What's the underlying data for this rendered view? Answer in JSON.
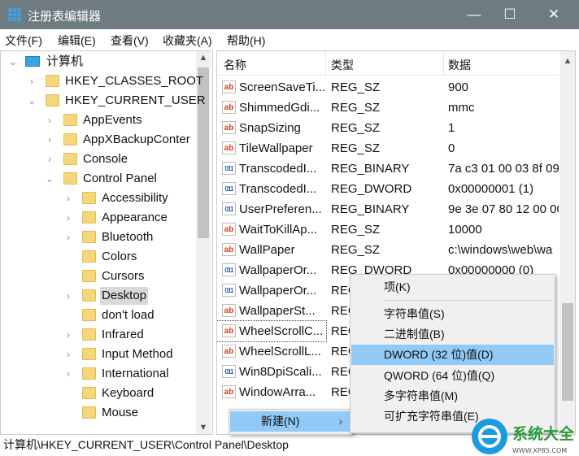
{
  "window": {
    "title": "注册表编辑器",
    "minimize": "—",
    "maximize": "☐",
    "close": "✕"
  },
  "menubar": [
    "文件(F)",
    "编辑(E)",
    "查看(V)",
    "收藏夹(A)",
    "帮助(H)"
  ],
  "tree": [
    {
      "label": "计算机",
      "level": 0,
      "expanded": true,
      "icon": "computer-icon"
    },
    {
      "label": "HKEY_CLASSES_ROOT",
      "level": 1,
      "expanded": false
    },
    {
      "label": "HKEY_CURRENT_USER",
      "level": 1,
      "expanded": true
    },
    {
      "label": "AppEvents",
      "level": 2,
      "expanded": false
    },
    {
      "label": "AppXBackupConter",
      "level": 2,
      "expanded": false
    },
    {
      "label": "Console",
      "level": 2,
      "expanded": false
    },
    {
      "label": "Control Panel",
      "level": 2,
      "expanded": true
    },
    {
      "label": "Accessibility",
      "level": 3,
      "expanded": false
    },
    {
      "label": "Appearance",
      "level": 3,
      "expanded": false
    },
    {
      "label": "Bluetooth",
      "level": 3,
      "expanded": false
    },
    {
      "label": "Colors",
      "level": 3,
      "leaf": true
    },
    {
      "label": "Cursors",
      "level": 3,
      "leaf": true
    },
    {
      "label": "Desktop",
      "level": 3,
      "expanded": false,
      "selected": true
    },
    {
      "label": "don't load",
      "level": 3,
      "leaf": true
    },
    {
      "label": "Infrared",
      "level": 3,
      "expanded": false
    },
    {
      "label": "Input Method",
      "level": 3,
      "expanded": false
    },
    {
      "label": "International",
      "level": 3,
      "expanded": false
    },
    {
      "label": "Keyboard",
      "level": 3,
      "leaf": true
    },
    {
      "label": "Mouse",
      "level": 3,
      "leaf": true
    }
  ],
  "list": {
    "columns": [
      "名称",
      "类型",
      "数据"
    ],
    "rows": [
      {
        "name": "ScreenSaveTi...",
        "type": "REG_SZ",
        "data": "900",
        "icon": "ab"
      },
      {
        "name": "ShimmedGdi...",
        "type": "REG_SZ",
        "data": "mmc",
        "icon": "ab"
      },
      {
        "name": "SnapSizing",
        "type": "REG_SZ",
        "data": "1",
        "icon": "ab"
      },
      {
        "name": "TileWallpaper",
        "type": "REG_SZ",
        "data": "0",
        "icon": "ab"
      },
      {
        "name": "TranscodedI...",
        "type": "REG_BINARY",
        "data": "7a c3 01 00 03 8f 09",
        "icon": "bin"
      },
      {
        "name": "TranscodedI...",
        "type": "REG_DWORD",
        "data": "0x00000001 (1)",
        "icon": "bin"
      },
      {
        "name": "UserPreferen...",
        "type": "REG_BINARY",
        "data": "9e 3e 07 80 12 00 00",
        "icon": "bin"
      },
      {
        "name": "WaitToKillAp...",
        "type": "REG_SZ",
        "data": "10000",
        "icon": "ab"
      },
      {
        "name": "WallPaper",
        "type": "REG_SZ",
        "data": "c:\\windows\\web\\wa",
        "icon": "ab"
      },
      {
        "name": "WallpaperOr...",
        "type": "REG_DWORD",
        "data": "0x00000000 (0)",
        "icon": "bin"
      },
      {
        "name": "WallpaperOr...",
        "type": "REG",
        "data": "",
        "icon": "bin"
      },
      {
        "name": "WallpaperSt...",
        "type": "REG",
        "data": "",
        "icon": "ab"
      },
      {
        "name": "WheelScrollC...",
        "type": "REG",
        "data": "",
        "icon": "ab",
        "focused": true
      },
      {
        "name": "WheelScrollL...",
        "type": "REG",
        "data": "",
        "icon": "ab"
      },
      {
        "name": "Win8DpiScali...",
        "type": "REG",
        "data": "",
        "icon": "bin"
      },
      {
        "name": "WindowArra...",
        "type": "REG",
        "data": "",
        "icon": "ab"
      }
    ]
  },
  "context_menu": {
    "new_label": "新建(N)",
    "arrow": "›"
  },
  "submenu": [
    {
      "label": "项(K)"
    },
    {
      "separator": true
    },
    {
      "label": "字符串值(S)"
    },
    {
      "label": "二进制值(B)"
    },
    {
      "label": "DWORD (32 位)值(D)",
      "highlighted": true
    },
    {
      "label": "QWORD (64 位)值(Q)"
    },
    {
      "label": "多字符串值(M)"
    },
    {
      "label": "可扩充字符串值(E)"
    }
  ],
  "status": "计算机\\HKEY_CURRENT_USER\\Control Panel\\Desktop",
  "watermark": {
    "text": "系统大全",
    "url": "WWW.XP85.COM"
  }
}
